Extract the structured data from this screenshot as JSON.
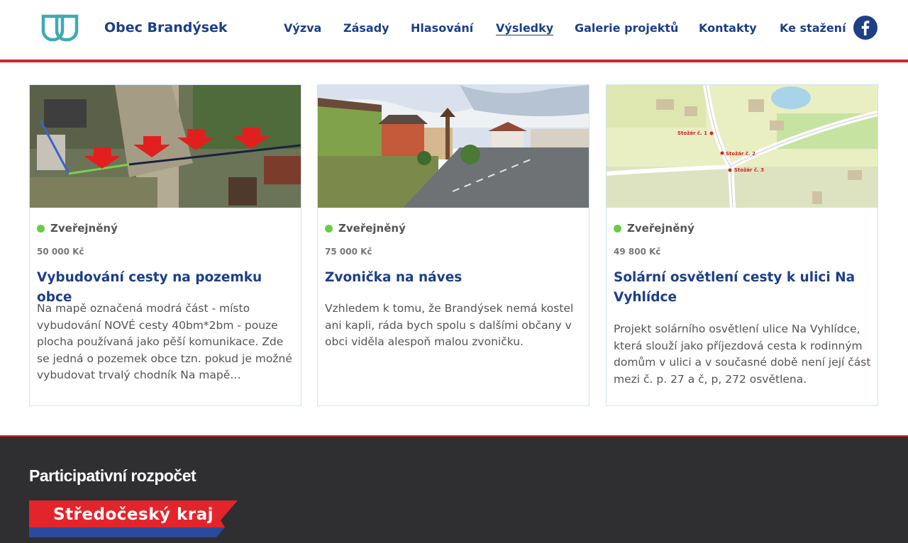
{
  "header": {
    "brand": "Obec Brandýsek",
    "nav": [
      {
        "label": "Výzva",
        "active": false
      },
      {
        "label": "Zásady",
        "active": false
      },
      {
        "label": "Hlasování",
        "active": false
      },
      {
        "label": "Výsledky",
        "active": true
      },
      {
        "label": "Galerie projektů",
        "active": false
      },
      {
        "label": "Kontakty",
        "active": false
      },
      {
        "label": "Ke stažení",
        "active": false
      }
    ],
    "facebook_icon": "facebook-icon"
  },
  "projects": [
    {
      "status": "Zveřejněný",
      "price": "50 000 Kč",
      "title": "Vybudování cesty na pozemku obce",
      "description": "Na mapě označená modrá část - místo vybudování NOVÉ cesty 40bm*2bm - pouze plocha používaná jako pěší komunikace. Zde se jedná o pozemek obce tzn. pokud je možné vybudovat trvalý chodník Na mapě…"
    },
    {
      "status": "Zveřejněný",
      "price": "75 000 Kč",
      "title": "Zvonička na náves",
      "description": "Vzhledem k tomu, že Brandýsek nemá kostel ani kapli, ráda bych spolu s dalšími občany v obci viděla alespoň malou zvoničku."
    },
    {
      "status": "Zveřejněný",
      "price": "49 800 Kč",
      "title": "Solární osvětlení cesty k ulici Na Vyhlídce",
      "description": "Projekt solárního osvětlení ulice Na Vyhlídce, která slouží jako příjezdová cesta k rodinným domům v ulici a v současné době není její část mezi č. p. 27 a č, p, 272 osvětlena."
    }
  ],
  "map_labels": {
    "label1": "Stožár č. 1",
    "label2": "Stožár č. 2",
    "label3": "Stožár č. 3"
  },
  "footer": {
    "title": "Participativní rozpočet",
    "region": "Středočeský kraj"
  },
  "colors": {
    "brand_blue": "#1c3f87",
    "accent_red": "#d82027",
    "status_green": "#6bcb47",
    "footer_bg": "#2f2f31"
  }
}
